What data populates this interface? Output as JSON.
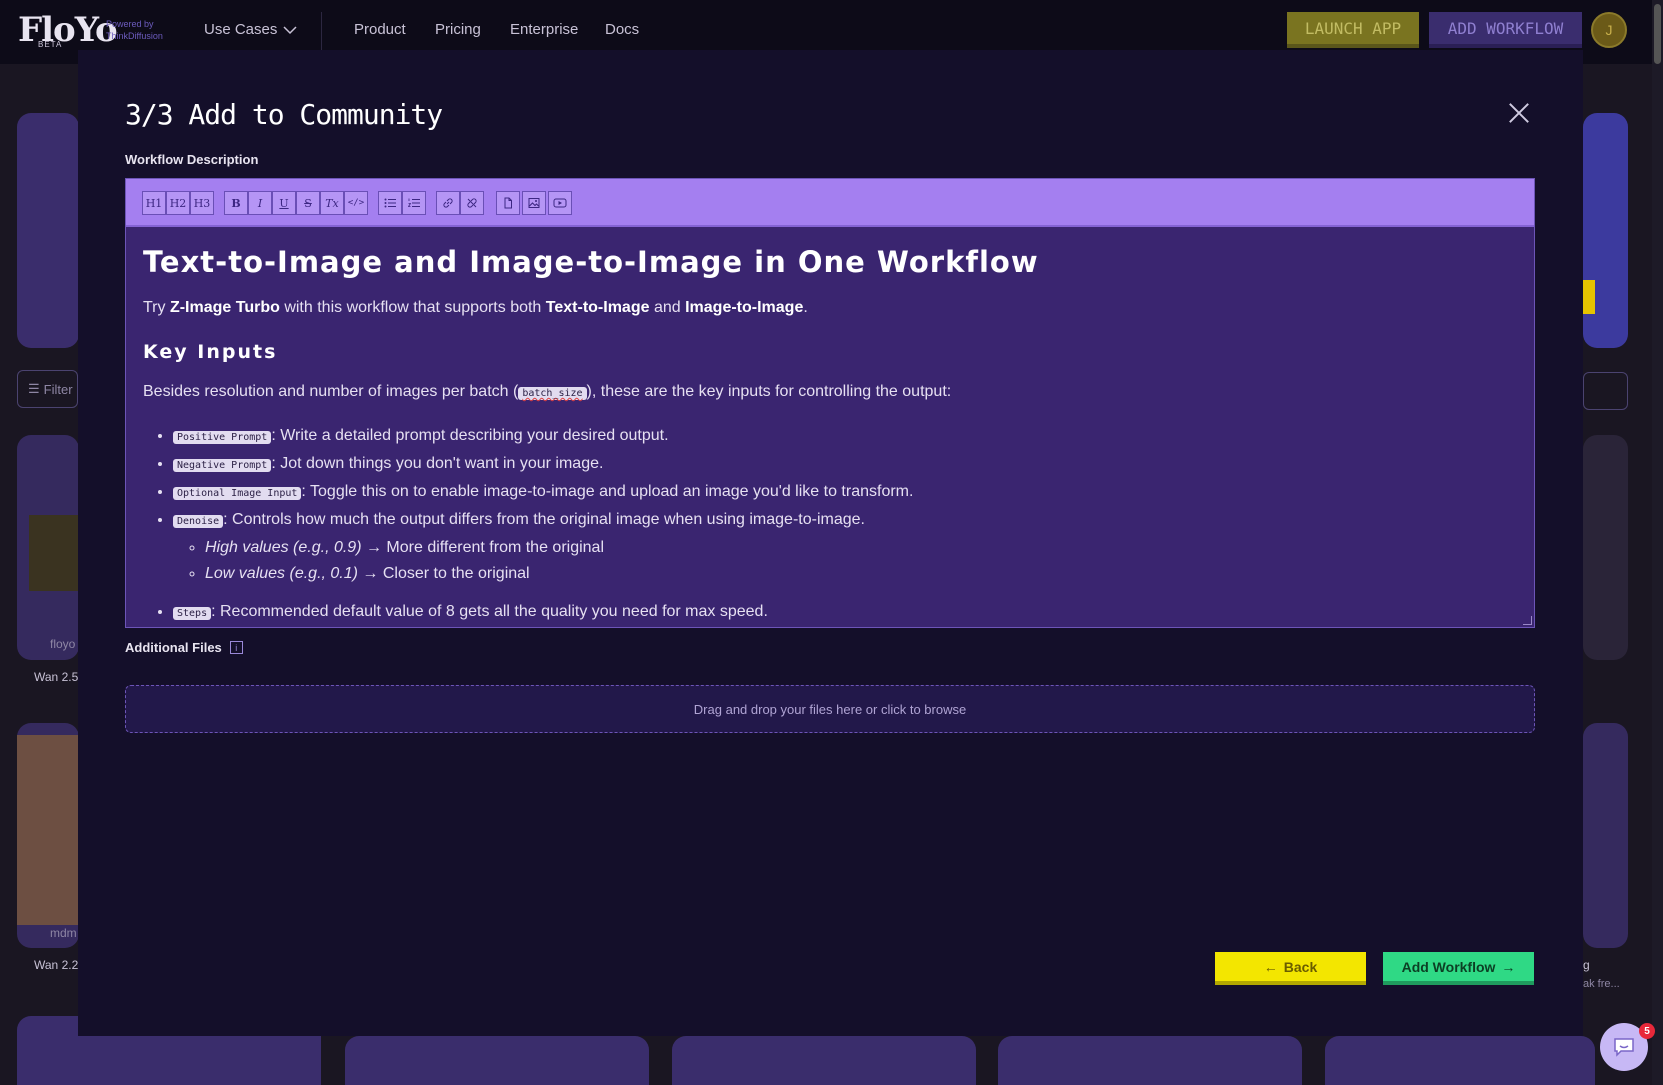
{
  "nav": {
    "logo": "FloYo",
    "logo_badge": "BETA",
    "powered_line1": "Powered by",
    "powered_line2": "ThinkDiffusion",
    "use_cases": "Use Cases",
    "links": [
      "Product",
      "Pricing",
      "Enterprise",
      "Docs"
    ],
    "launch_app": "LAUNCH APP",
    "add_workflow": "ADD WORKFLOW",
    "avatar_initial": "J"
  },
  "background": {
    "filter_label": "Filter",
    "card_user_1": "floyo",
    "card_caption_1": "Wan 2.5",
    "card_user_2": "mdm",
    "card_caption_2": "Wan 2.2",
    "right_caption": "g",
    "right_caption_2": "ak fre..."
  },
  "modal": {
    "title": "3/3 Add to Community",
    "description_label": "Workflow Description",
    "toolbar": [
      "H1",
      "H2",
      "H3",
      "B",
      "I",
      "U",
      "S",
      "Tx",
      "</>",
      "ul",
      "ol",
      "link",
      "unlink",
      "doc",
      "img",
      "video"
    ],
    "content": {
      "heading": "Text-to-Image and Image-to-Image in One Workflow",
      "intro_1": "Try ",
      "intro_b1": "Z-Image Turbo",
      "intro_2": " with this workflow that supports both ",
      "intro_b2": "Text-to-Image",
      "intro_3": " and ",
      "intro_b3": "Image-to-Image",
      "intro_4": ".",
      "key_inputs_heading": "Key Inputs",
      "besides_1": "Besides resolution and number of images per batch (",
      "besides_code": "batch_size",
      "besides_2": "), these are the key inputs for controlling the output:",
      "items": [
        {
          "code": "Positive Prompt",
          "text": ": Write a detailed prompt describing your desired output."
        },
        {
          "code": "Negative Prompt",
          "text": ": Jot down things you don't want in your image."
        },
        {
          "code": "Optional Image Input",
          "text": ": Toggle this on to enable image-to-image and upload an image you'd like to transform."
        },
        {
          "code": "Denoise",
          "text": ": Controls how much the output differs from the original image when using image-to-image."
        }
      ],
      "sub_items": [
        {
          "italic": "High values (e.g., 0.9)",
          "text": " → More different from the original"
        },
        {
          "italic": "Low values (e.g., 0.1)",
          "text": " → Closer to the original"
        }
      ],
      "cut_item": {
        "code": "Steps",
        "text": ": Recommended default value of 8 gets all the quality you need for max speed."
      }
    },
    "additional_files_label": "Additional Files",
    "info_glyph": "i",
    "dropzone_text": "Drag and drop your files here or click to browse",
    "back_label": "Back",
    "add_workflow_label": "Add Workflow"
  },
  "chat": {
    "badge": "5"
  }
}
